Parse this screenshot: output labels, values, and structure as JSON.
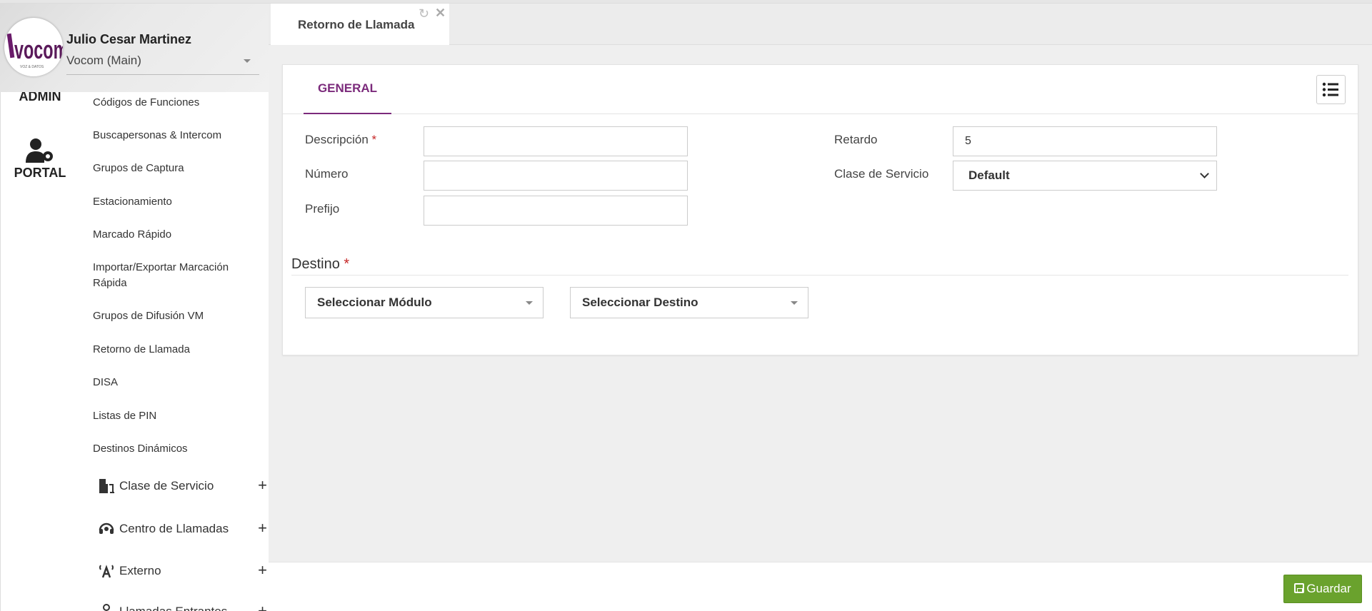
{
  "profile": {
    "user_name": "Julio Cesar Martinez",
    "tenant": "Vocom (Main)",
    "logo_text": "vocom"
  },
  "rail": {
    "admin_label": "ADMIN",
    "portal_label": "PORTAL"
  },
  "submenu": {
    "items": [
      {
        "label": "Códigos de Funciones"
      },
      {
        "label": "Buscapersonas & Intercom"
      },
      {
        "label": "Grupos de Captura"
      },
      {
        "label": "Estacionamiento"
      },
      {
        "label": "Marcado Rápido"
      },
      {
        "label": "Importar/Exportar Marcación Rápida"
      },
      {
        "label": "Grupos de Difusión VM"
      },
      {
        "label": "Retorno de Llamada"
      },
      {
        "label": "DISA"
      },
      {
        "label": "Listas de PIN"
      },
      {
        "label": "Destinos Dinámicos"
      }
    ],
    "groups": [
      {
        "label": "Clase de Servicio",
        "icon": "door-icon"
      },
      {
        "label": "Centro de Llamadas",
        "icon": "headset-icon"
      },
      {
        "label": "Externo",
        "icon": "antenna-icon"
      },
      {
        "label": "Llamadas Entrantes",
        "icon": "pin-icon"
      }
    ],
    "expand_symbol": "+"
  },
  "tabs": {
    "active_label": "Retorno de Llamada"
  },
  "card": {
    "tab_general": "GENERAL",
    "fields": {
      "descripcion_label": "Descripción",
      "descripcion_value": "",
      "numero_label": "Número",
      "numero_value": "",
      "prefijo_label": "Prefijo",
      "prefijo_value": "",
      "retardo_label": "Retardo",
      "retardo_value": "5",
      "clase_servicio_label": "Clase de Servicio",
      "clase_servicio_value": "Default"
    },
    "required_mark": "*",
    "destino_title": "Destino",
    "select_modulo": "Seleccionar Módulo",
    "select_destino": "Seleccionar Destino"
  },
  "footer": {
    "save_label": "Guardar"
  },
  "colors": {
    "accent": "#7b2a7b",
    "save": "#6aa22d",
    "required": "#c62828"
  }
}
